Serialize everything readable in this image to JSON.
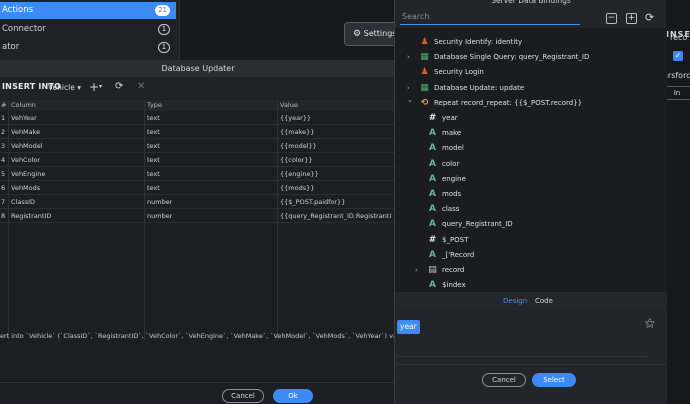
{
  "background_left": {
    "items": [
      {
        "label": "Actions",
        "count": "21",
        "active": true
      },
      {
        "label": "Connector",
        "count": "1",
        "active": false
      },
      {
        "label": "ator",
        "count": "1",
        "active": false
      }
    ]
  },
  "settings_button": {
    "label": "Settings"
  },
  "background_right": {
    "heading": "INSER",
    "row1": "reco",
    "row2": "arsforc",
    "row3": "In"
  },
  "database_updater": {
    "title": "Database Updater",
    "toolbar": {
      "label": "INSERT INTO",
      "table": "Vehicle"
    },
    "columns": [
      "#",
      "Column",
      "Type",
      "Value"
    ],
    "rows": [
      {
        "num": "1",
        "column": "VehYear",
        "type": "text",
        "value": "{{year}}"
      },
      {
        "num": "2",
        "column": "VehMake",
        "type": "text",
        "value": "{{make}}"
      },
      {
        "num": "3",
        "column": "VehModel",
        "type": "text",
        "value": "{{model}}"
      },
      {
        "num": "4",
        "column": "VehColor",
        "type": "text",
        "value": "{{color}}"
      },
      {
        "num": "5",
        "column": "VehEngine",
        "type": "text",
        "value": "{{engine}}"
      },
      {
        "num": "6",
        "column": "VehMods",
        "type": "text",
        "value": "{{mods}}"
      },
      {
        "num": "7",
        "column": "ClassID",
        "type": "number",
        "value": "{{$_POST.paidfor}}"
      },
      {
        "num": "8",
        "column": "RegistrantID",
        "type": "number",
        "value": "{{query_Registrant_ID.RegistrantI"
      }
    ],
    "sql": "ert into `Vehicle` (`ClassID`, `RegistrantID`, `VehColor`, `VehEngine`, `VehMake`, `VehModel`, `VehMods`, `VehYear`) value",
    "cancel_label": "Cancel",
    "ok_label": "Ok"
  },
  "server_bindings": {
    "title": "Server Data Bindings",
    "search_placeholder": "Search",
    "tree": [
      {
        "label": "Security Identify: identity",
        "icon": "security-icon",
        "indent": 0,
        "chevron": ""
      },
      {
        "label": "Database Single Query: query_Registrant_ID",
        "icon": "database-icon",
        "indent": 0,
        "chevron": "›"
      },
      {
        "label": "Security Login",
        "icon": "security-icon",
        "indent": 0,
        "chevron": ""
      },
      {
        "label": "Database Update: update",
        "icon": "database-icon",
        "indent": 0,
        "chevron": "›"
      },
      {
        "label": "Repeat record_repeat: {{$_POST.record}}",
        "icon": "repeat-icon",
        "indent": 0,
        "chevron": "⌄"
      },
      {
        "label": "year",
        "icon": "#",
        "indent": 1,
        "chevron": ""
      },
      {
        "label": "make",
        "icon": "A",
        "indent": 1,
        "chevron": ""
      },
      {
        "label": "model",
        "icon": "A",
        "indent": 1,
        "chevron": ""
      },
      {
        "label": "color",
        "icon": "A",
        "indent": 1,
        "chevron": ""
      },
      {
        "label": "engine",
        "icon": "A",
        "indent": 1,
        "chevron": ""
      },
      {
        "label": "mods",
        "icon": "A",
        "indent": 1,
        "chevron": ""
      },
      {
        "label": "class",
        "icon": "A",
        "indent": 1,
        "chevron": ""
      },
      {
        "label": "query_Registrant_ID",
        "icon": "A",
        "indent": 1,
        "chevron": ""
      },
      {
        "label": "$_POST",
        "icon": "#",
        "indent": 1,
        "chevron": ""
      },
      {
        "label": "_['Record",
        "icon": "A",
        "indent": 1,
        "chevron": ""
      },
      {
        "label": "record",
        "icon": "list-icon",
        "indent": 1,
        "chevron": "›"
      },
      {
        "label": "$index",
        "icon": "A",
        "indent": 1,
        "chevron": ""
      }
    ],
    "tabs": {
      "design": "Design",
      "code": "Code"
    },
    "selected_chip": "year",
    "cancel_label": "Cancel",
    "select_label": "Select"
  }
}
